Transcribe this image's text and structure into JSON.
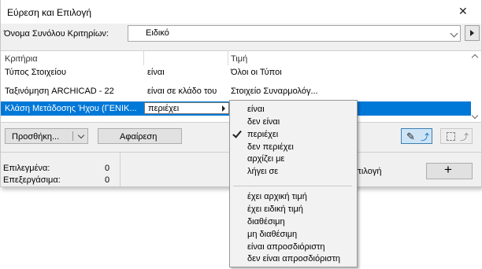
{
  "window": {
    "title": "Εύρεση και Επιλογή",
    "close_icon": "✕"
  },
  "criteria_set": {
    "label": "Όνομα Συνόλου Κριτηρίων:",
    "value": "Ειδικό"
  },
  "table": {
    "headers": [
      "Κριτήρια",
      "",
      "Τιμή"
    ],
    "rows": [
      {
        "criterion": "Τύπος Στοιχείου",
        "operator": "είναι",
        "value": "Όλοι οι Τύποι"
      },
      {
        "criterion": "Ταξινόμηση ARCHICAD - 22",
        "operator": "είναι σε κλάδο του",
        "value": "Στοιχείο Συναρμολόγ..."
      },
      {
        "criterion": "Κλάση Μετάδοσης Ήχου (ΓΕΝΙΚ...",
        "operator": "περιέχει",
        "value": ""
      }
    ]
  },
  "buttons": {
    "add": "Προσθήκη...",
    "remove": "Αφαίρεση",
    "plus": "+"
  },
  "stats": {
    "selected_label": "Επιλεγμένα:",
    "selected_value": "0",
    "editable_label": "Επεξεργάσιμα:",
    "editable_value": "0"
  },
  "selection_label": "Επιλογή",
  "menu": {
    "group1": [
      "είναι",
      "δεν είναι",
      "περιέχει",
      "δεν περιέχει",
      "αρχίζει με",
      "λήγει σε"
    ],
    "group2": [
      "έχει αρχική τιμή",
      "έχει ειδική τιμή",
      "διαθέσιμη",
      "μη διαθέσιμη",
      "είναι απροσδιόριστη",
      "δεν είναι απροσδιόριστη"
    ],
    "checked_index": 2
  },
  "colors": {
    "selection": "#0078d7",
    "accent_button": "#cde4f7"
  }
}
